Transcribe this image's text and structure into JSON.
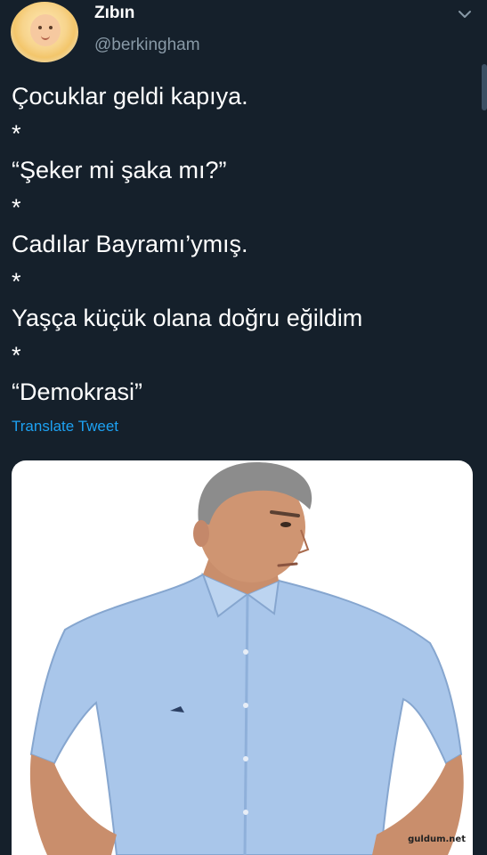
{
  "tweet": {
    "author": {
      "display_name": "Zıbın",
      "handle": "@berkingham"
    },
    "text_lines": [
      "Çocuklar geldi kapıya.",
      "*",
      "“Şeker mi şaka mı?”",
      "*",
      "Cadılar Bayramı’ymış.",
      "*",
      "Yaşça küçük olana doğru eğildim",
      "*",
      "“Demokrasi”"
    ],
    "translate_label": "Translate Tweet",
    "media": {
      "watermark": "guldum.net"
    }
  },
  "icons": {
    "caret": "chevron-down-icon"
  },
  "colors": {
    "background": "#15202b",
    "text": "#ffffff",
    "secondary_text": "#8899a6",
    "link": "#1da1f2",
    "shirt": "#a9c6ea"
  }
}
